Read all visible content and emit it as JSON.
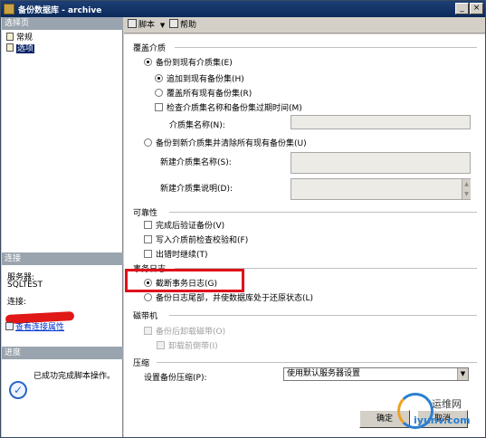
{
  "window": {
    "title": "备份数据库 - archive"
  },
  "left": {
    "select_page_header": "选择页",
    "pages": [
      {
        "label": "常规",
        "selected": false
      },
      {
        "label": "选项",
        "selected": true
      }
    ],
    "connection_header": "连接",
    "server_label": "服务器:",
    "server_value": "SQLTEST",
    "connection_label": "连接:",
    "view_link": "查看连接属性",
    "progress_header": "进度",
    "progress_status": "已成功完成脚本操作。"
  },
  "toolbar": {
    "script_label": "脚本",
    "help_label": "帮助"
  },
  "main": {
    "overwrite_media": {
      "header": "覆盖介质",
      "backup_existing": "备份到现有介质集(E)",
      "append": "追加到现有备份集(H)",
      "overwrite_all": "覆盖所有现有备份集(R)",
      "check_name": "检查介质集名称和备份集过期时间(M)",
      "media_name_label": "介质集名称(N):",
      "backup_new": "备份到新介质集并清除所有现有备份集(U)",
      "new_media_name_label": "新建介质集名称(S):",
      "new_media_desc_label": "新建介质集说明(D):"
    },
    "reliability": {
      "header": "可靠性",
      "verify": "完成后验证备份(V)",
      "checksum": "写入介质前检查校验和(F)",
      "continue_on_error": "出错时继续(T)"
    },
    "transaction_log": {
      "header": "事务日志",
      "truncate": "截断事务日志(G)",
      "tail": "备份日志尾部，并使数据库处于还原状态(L)"
    },
    "tape": {
      "header": "磁带机",
      "unload": "备份后卸载磁带(O)",
      "rewind": "卸载前倒带(I)"
    },
    "compression": {
      "header": "压缩",
      "label": "设置备份压缩(P):",
      "value": "使用默认服务器设置"
    }
  },
  "buttons": {
    "ok": "确定",
    "cancel": "取消"
  },
  "watermark": {
    "line1": "运维网",
    "line2": "iyunv.com"
  },
  "colors": {
    "highlight": "#e0101a",
    "title_bar": "#0c2a5c",
    "selection": "#0a246a"
  }
}
